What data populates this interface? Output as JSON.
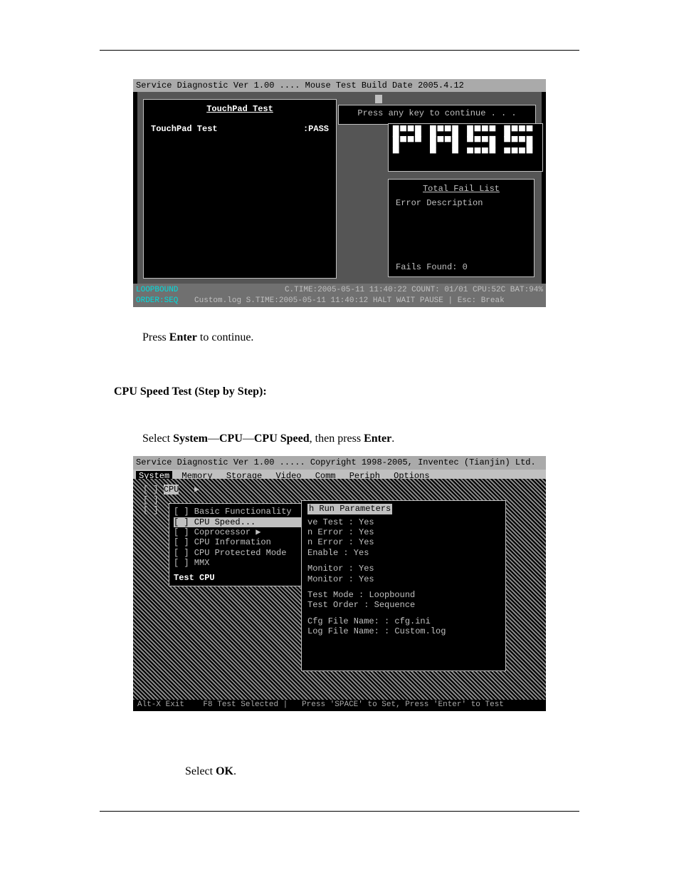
{
  "shot1": {
    "title": "Service Diagnostic Ver 1.00 .... Mouse Test Build Date 2005.4.12",
    "left_title": "TouchPad Test",
    "left_line": "TouchPad Test",
    "left_status": ":PASS",
    "popup": "Press any key to continue . . .",
    "pass_art": "█▀▀█ █▀▀█ █▀▀▀ █▀▀▀\n█▀▀▀ █▀▀█ ▀▀▀█ ▀▀▀█\n▀    ▀  ▀ ▀▀▀▀ ▀▀▀▀",
    "fail_title": "Total Fail List",
    "fail_cols": "Error  Description",
    "fail_count": "Fails Found: 0",
    "status1_left": "LOOPBOUND",
    "status1_right": "C.TIME:2005-05-11 11:40:22 COUNT: 01/01  CPU:52C BAT:94%",
    "status2_left": "ORDER:SEQ",
    "status2_right": "Custom.log S.TIME:2005-05-11 11:40:12 HALT WAIT PAUSE  |  Esc: Break"
  },
  "text1": {
    "p1_a": "Press ",
    "p1_b": "Enter",
    "p1_c": " to continue.",
    "sec_hdr": "CPU Speed Test (Step by Step):",
    "p2_a": "Select ",
    "p2_b": "System",
    "p2_c": "—",
    "p2_d": "CPU",
    "p2_e": "—",
    "p2_f": "CPU Speed",
    "p2_g": ", then press ",
    "p2_h": "Enter",
    "p2_i": "."
  },
  "shot2": {
    "title": "Service Diagnostic Ver 1.00  ..... Copyright 1998-2005, Inventec (Tianjin) Ltd.",
    "menubar": [
      "System",
      "Memory",
      "Storage",
      "Video",
      "Comm",
      "Periph",
      "Options"
    ],
    "top_item": "CPU",
    "submenu": {
      "items": [
        "[ ] Basic Functionality",
        "[ ] CPU Speed...",
        "[ ] Coprocessor         ▶",
        "[ ] CPU Information",
        "[ ] CPU Protected Mode",
        "[ ] MMX"
      ],
      "footer": "Test CPU"
    },
    "params": {
      "header": "h Run Parameters",
      "rows": [
        "ve Test : Yes",
        "n Error : Yes",
        "n Error : Yes",
        " Enable : Yes",
        "",
        "Monitor : Yes",
        "Monitor : Yes",
        "",
        "   Test Mode : Loopbound",
        "  Test Order : Sequence",
        "",
        "Cfg File Name: : cfg.ini",
        "Log File Name: : Custom.log"
      ]
    },
    "footer_left": "Alt-X Exit",
    "footer_mid": "F8 Test Selected |",
    "footer_right": "Press 'SPACE' to Set, Press 'Enter' to Test"
  },
  "text2": {
    "p3_a": "Select ",
    "p3_b": "OK",
    "p3_c": "."
  }
}
